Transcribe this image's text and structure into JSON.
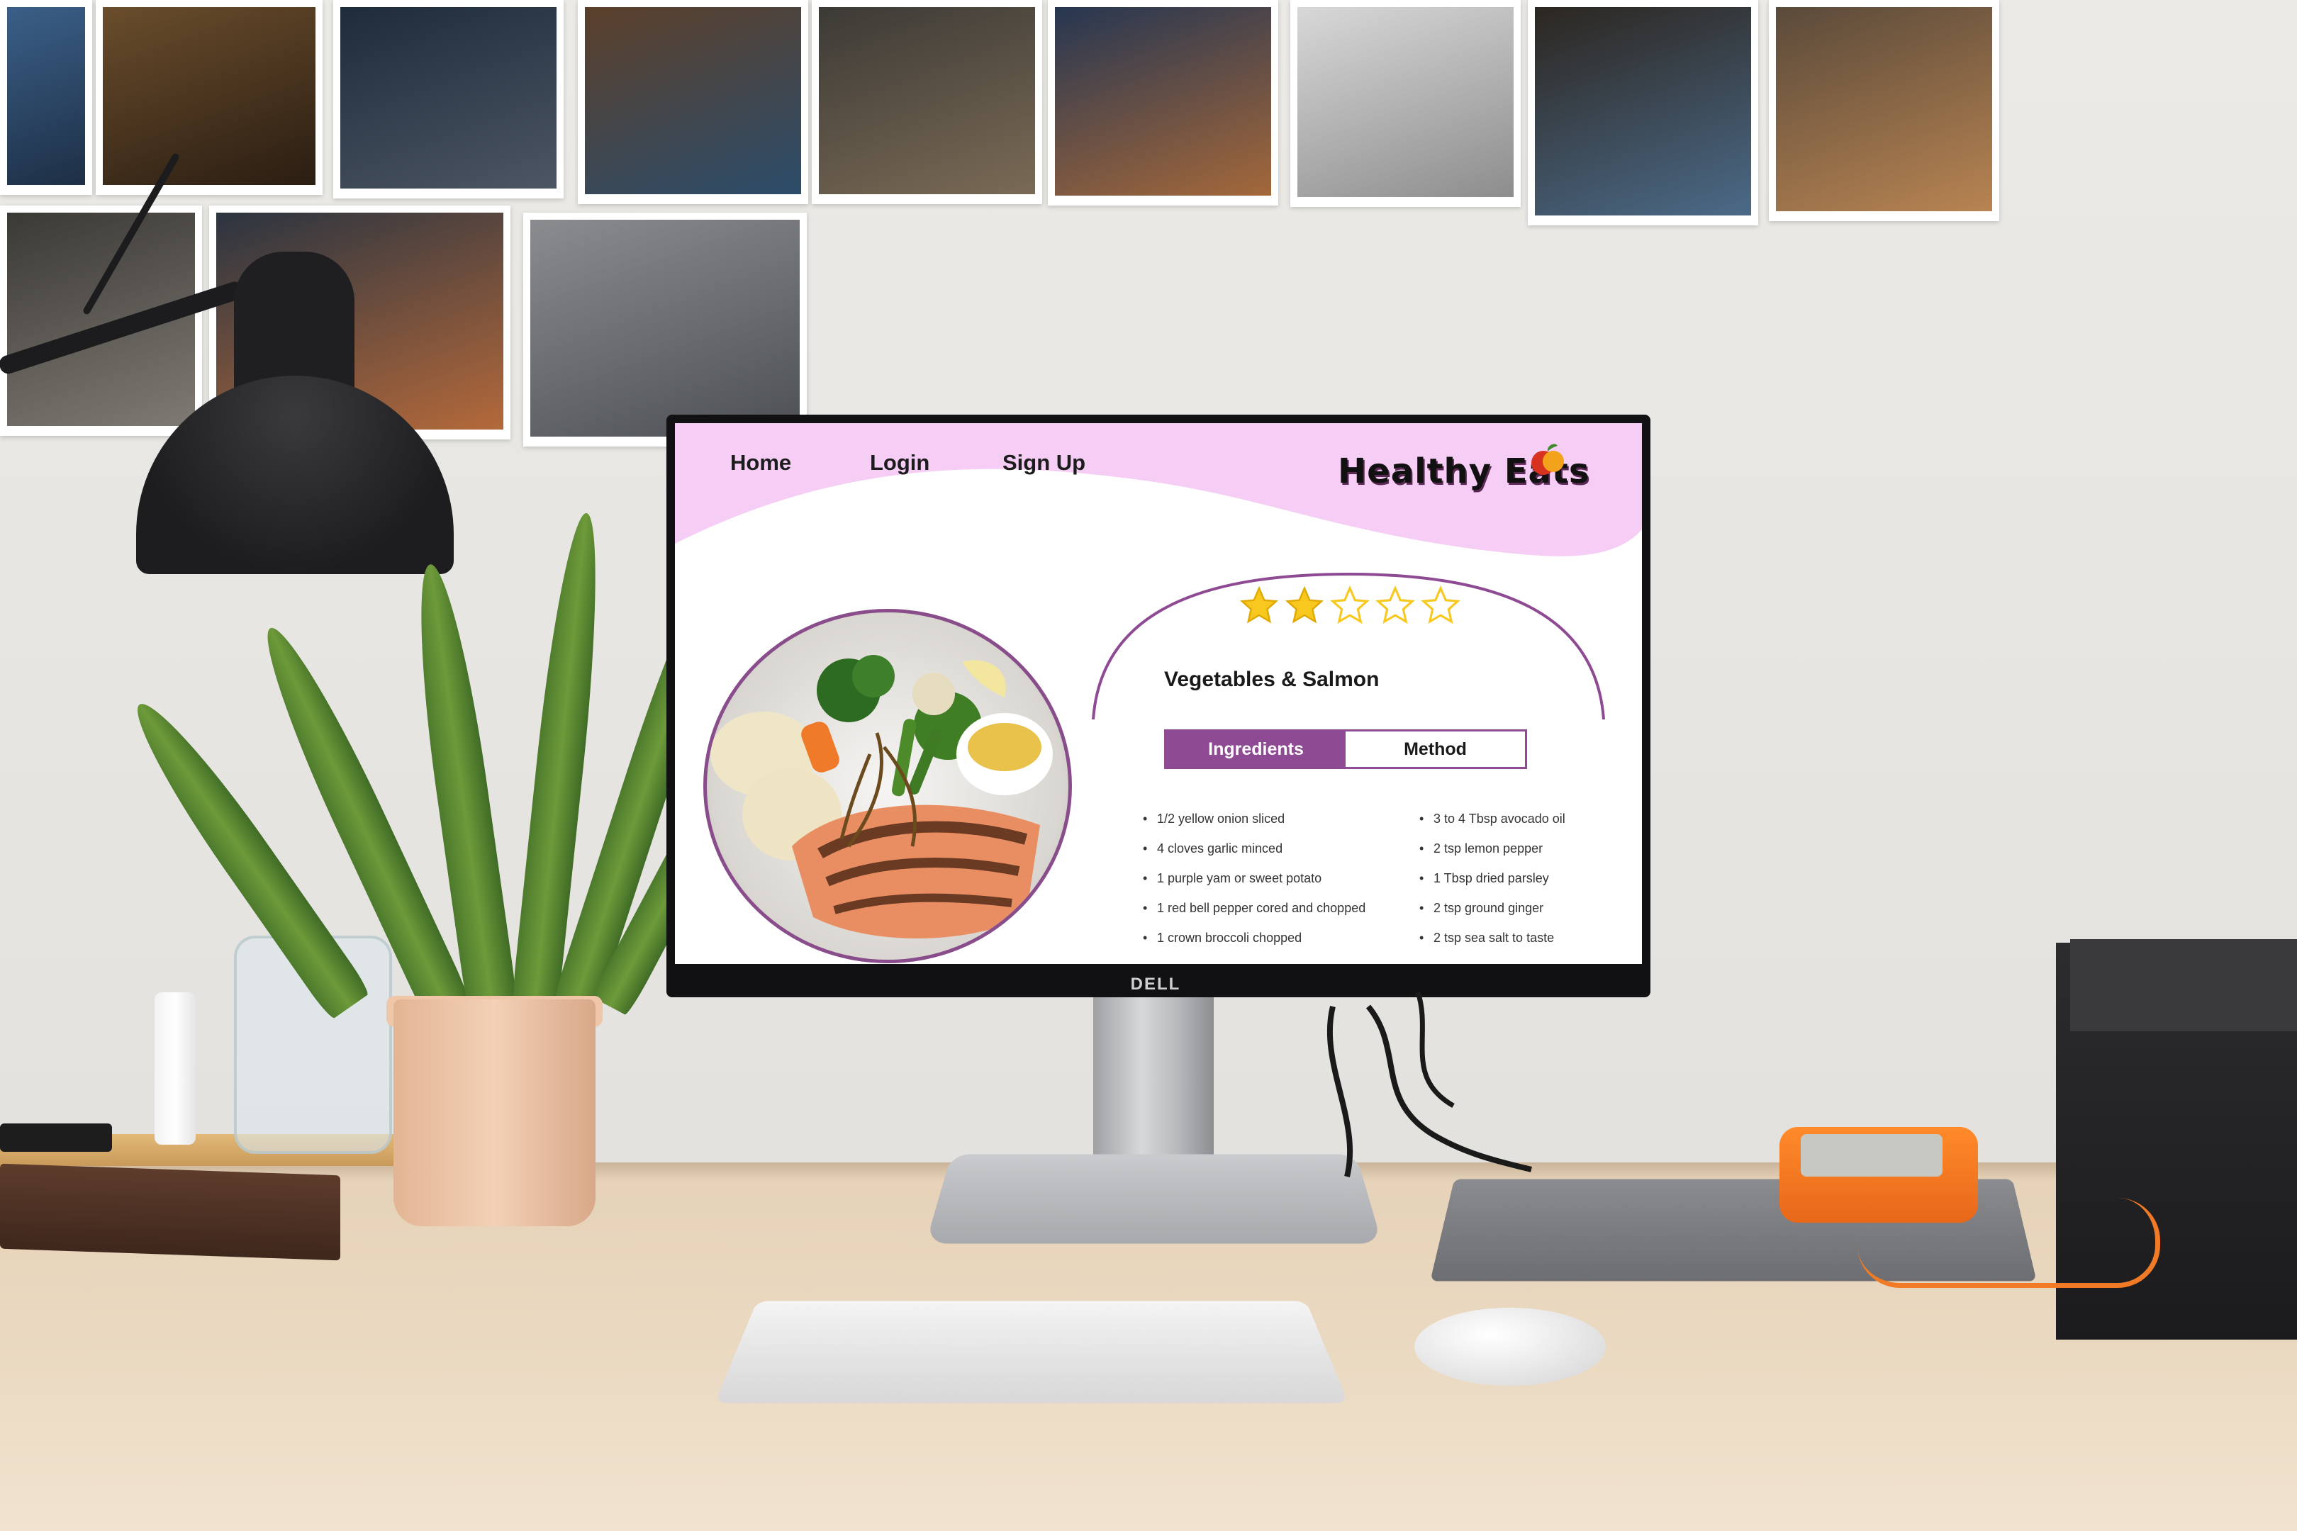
{
  "site": {
    "nav": {
      "home": "Home",
      "login": "Login",
      "signup": "Sign Up"
    },
    "brand": "Healthy Eats",
    "colors": {
      "header_pink": "#f5cdf5",
      "accent_purple": "#8e4a93",
      "star_yellow": "#f7c81e"
    }
  },
  "recipe": {
    "title": "Vegetables & Salmon",
    "rating": {
      "value": 2,
      "max": 5
    },
    "tabs": {
      "ingredients": "Ingredients",
      "method": "Method",
      "active": "ingredients"
    },
    "ingredients_left": [
      "1/2 yellow onion sliced",
      "4 cloves garlic minced",
      "1 purple yam or sweet potato",
      "1 red bell pepper cored and chopped",
      "1 crown broccoli chopped"
    ],
    "ingredients_right": [
      "3 to 4 Tbsp avocado oil",
      "2 tsp lemon pepper",
      "1 Tbsp dried parsley",
      "2 tsp ground ginger",
      "2 tsp sea salt to taste"
    ]
  },
  "hardware": {
    "monitor_logo": "DELL"
  }
}
